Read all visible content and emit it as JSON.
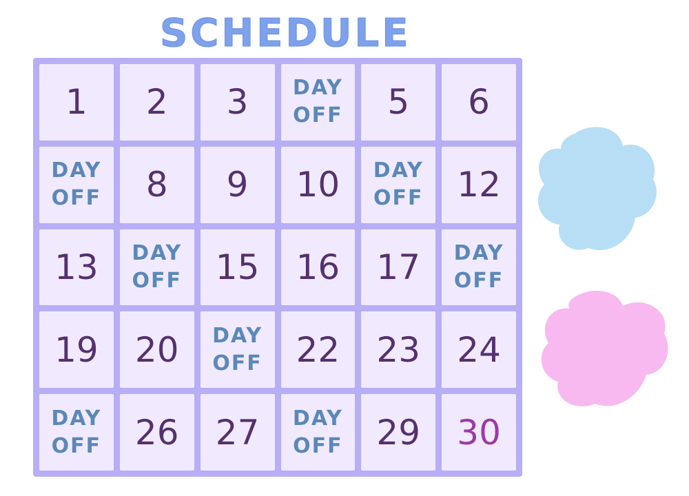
{
  "title": "SCHEDULE",
  "day_off_label": "DAY\nOFF",
  "colors": {
    "title": "#7ea1ec",
    "grid_border": "#b7aef6",
    "cell_bg": "#f1eafe",
    "number": "#55316f",
    "day_off": "#5b88b8",
    "highlight_number": "#9c3aa6",
    "blob_blue": "#b7def4",
    "blob_pink": "#f7b9ef"
  },
  "days": [
    {
      "label": "1"
    },
    {
      "label": "2"
    },
    {
      "label": "3"
    },
    {
      "label": "DAY\nOFF",
      "day_off": true
    },
    {
      "label": "5"
    },
    {
      "label": "6"
    },
    {
      "label": "DAY\nOFF",
      "day_off": true
    },
    {
      "label": "8"
    },
    {
      "label": "9"
    },
    {
      "label": "10"
    },
    {
      "label": "DAY\nOFF",
      "day_off": true
    },
    {
      "label": "12"
    },
    {
      "label": "13"
    },
    {
      "label": "DAY\nOFF",
      "day_off": true
    },
    {
      "label": "15"
    },
    {
      "label": "16"
    },
    {
      "label": "17"
    },
    {
      "label": "DAY\nOFF",
      "day_off": true
    },
    {
      "label": "19"
    },
    {
      "label": "20"
    },
    {
      "label": "DAY\nOFF",
      "day_off": true
    },
    {
      "label": "22"
    },
    {
      "label": "23"
    },
    {
      "label": "24"
    },
    {
      "label": "DAY\nOFF",
      "day_off": true
    },
    {
      "label": "26"
    },
    {
      "label": "27"
    },
    {
      "label": "DAY\nOFF",
      "day_off": true
    },
    {
      "label": "29"
    },
    {
      "label": "30",
      "highlight": true
    }
  ]
}
